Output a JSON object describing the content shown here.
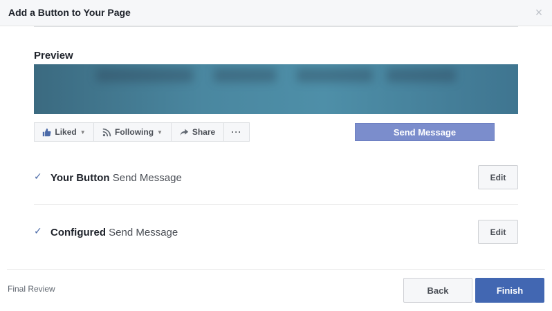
{
  "dialog": {
    "title": "Add a Button to Your Page",
    "close_icon": "close-icon"
  },
  "preview": {
    "label": "Preview",
    "actions": [
      {
        "label": "Liked",
        "icon": "thumbs-up-icon"
      },
      {
        "label": "Following",
        "icon": "rss-icon"
      },
      {
        "label": "Share",
        "icon": "share-arrow-icon"
      },
      {
        "label": "···",
        "icon": "more-icon"
      }
    ],
    "cta_label": "Send Message"
  },
  "rows": [
    {
      "title": "Your Button",
      "value": "Send Message",
      "edit_label": "Edit"
    },
    {
      "title": "Configured",
      "value": "Send Message",
      "edit_label": "Edit"
    }
  ],
  "footer": {
    "step_label": "Final Review",
    "back_label": "Back",
    "finish_label": "Finish"
  },
  "colors": {
    "primary": "#4267b2",
    "cta": "#7b8dcc",
    "check": "#4b6aa8"
  }
}
